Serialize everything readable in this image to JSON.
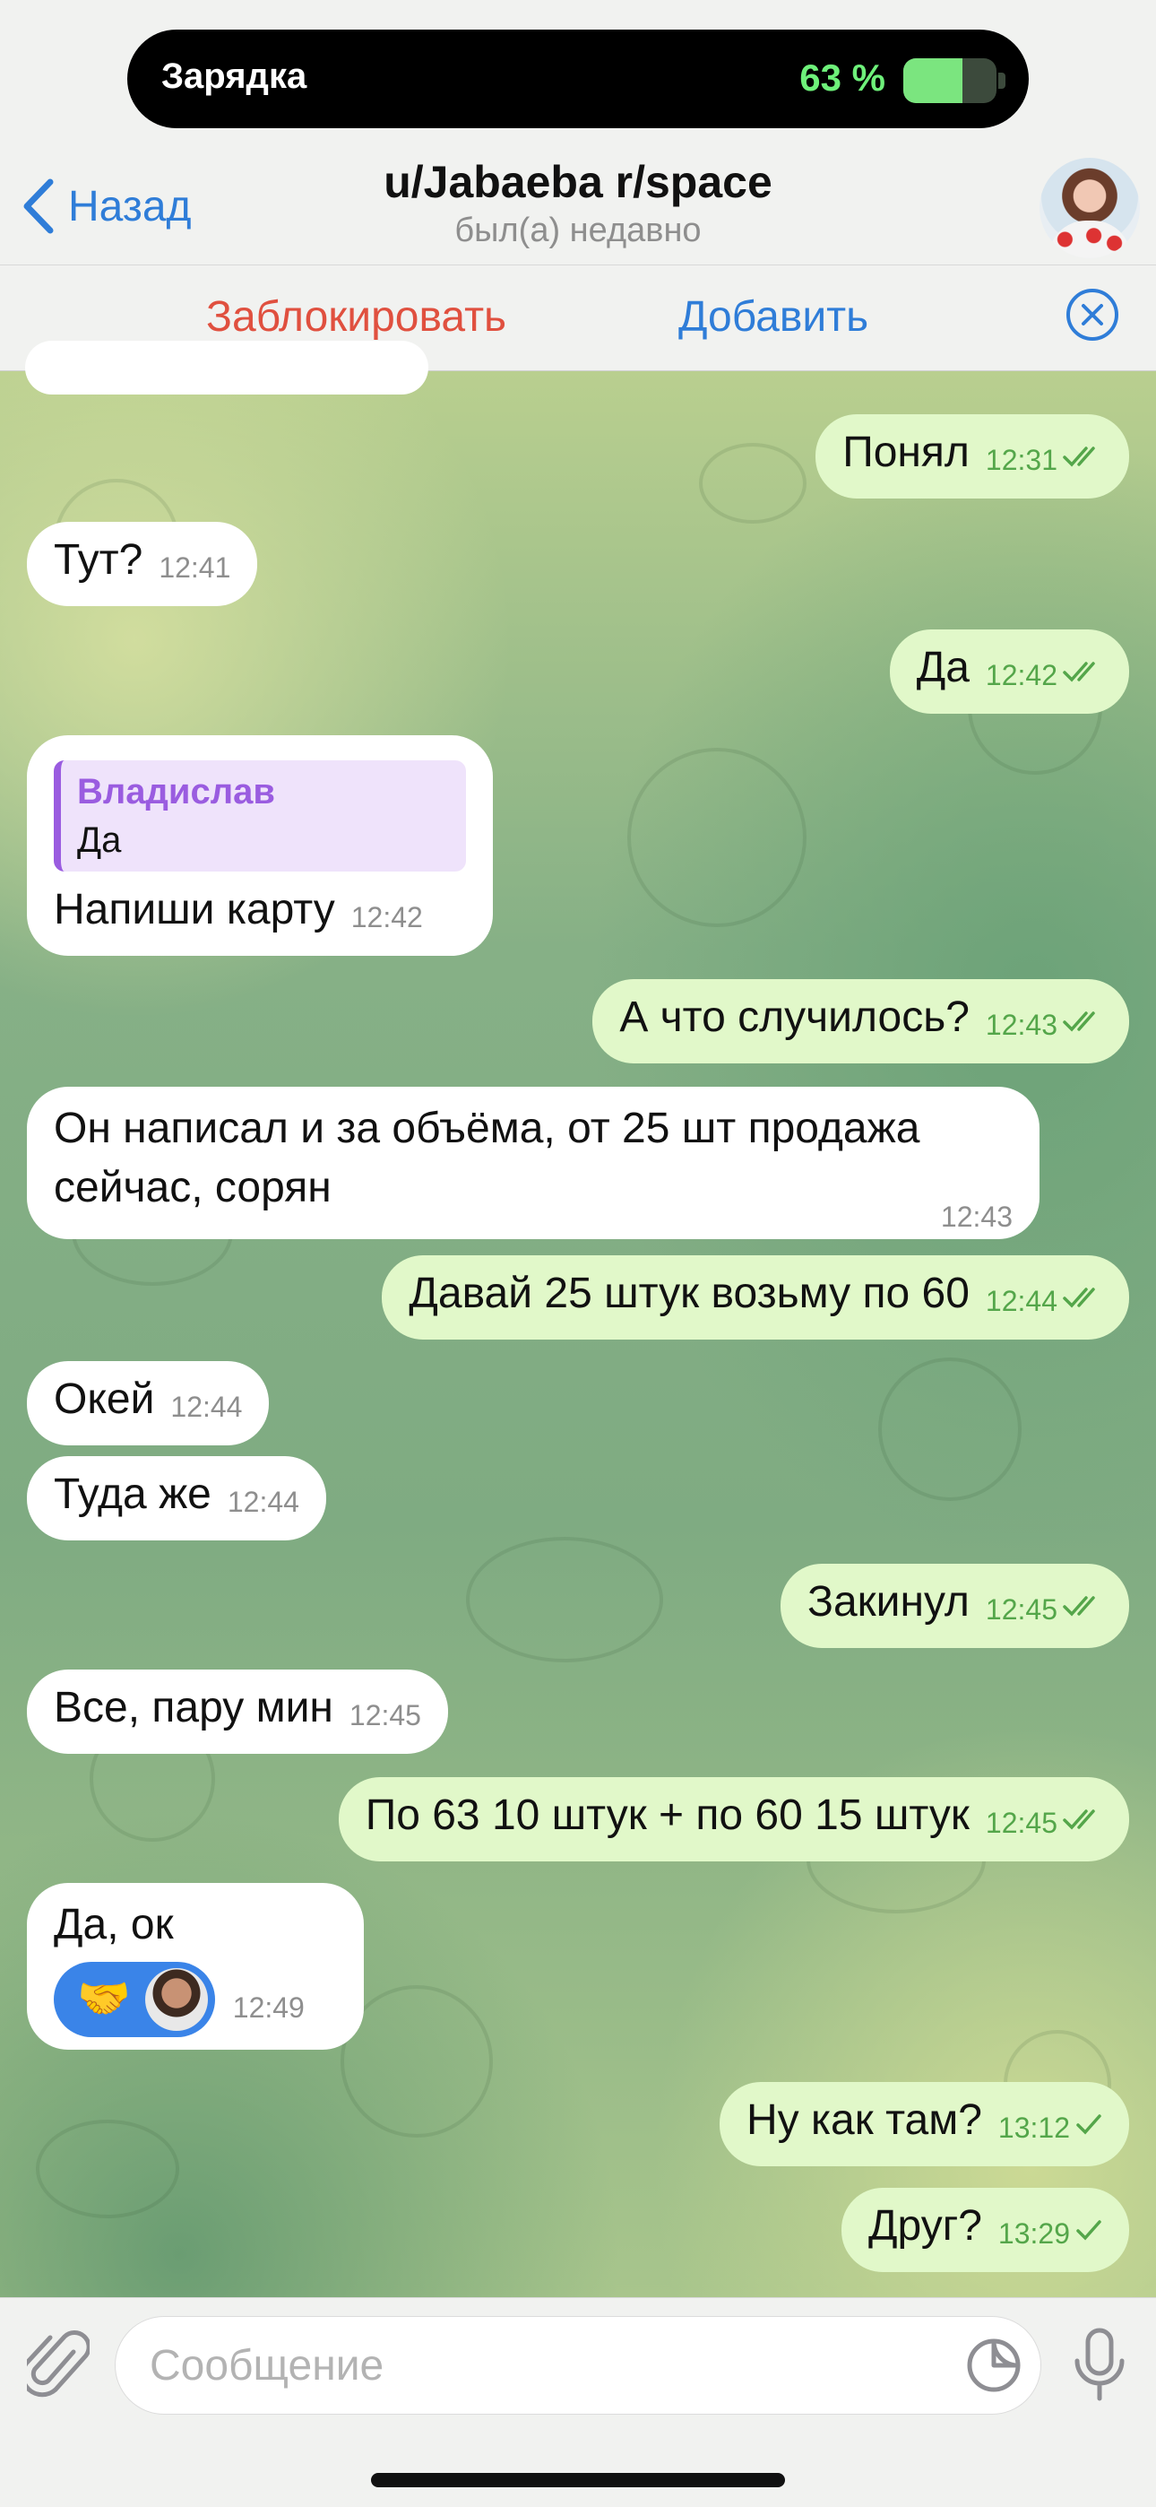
{
  "status_island": {
    "label": "Зарядка",
    "battery_text": "63 %",
    "battery_level": 0.63,
    "battery_color": "#7be57f"
  },
  "header": {
    "back_label": "Назад",
    "title": "u/Jabaeba r/space",
    "status": "был(а) недавно"
  },
  "action_bar": {
    "block_label": "Заблокировать",
    "add_label": "Добавить"
  },
  "colors": {
    "accent": "#2f7dd8",
    "danger": "#e0503f",
    "outgoing_bubble": "#e1f8c9",
    "incoming_bubble": "#ffffff",
    "reply_accent": "#9a5ce0"
  },
  "messages": [
    {
      "dir": "out",
      "text": "Понял",
      "time": "12:31",
      "read": true
    },
    {
      "dir": "in",
      "text": "Тут?",
      "time": "12:41"
    },
    {
      "dir": "out",
      "text": "Да",
      "time": "12:42",
      "read": true
    },
    {
      "dir": "in",
      "reply_to": {
        "author": "Владислав",
        "text": "Да"
      },
      "text": "Напиши карту",
      "time": "12:42"
    },
    {
      "dir": "out",
      "text": "А что случилось?",
      "time": "12:43",
      "read": true
    },
    {
      "dir": "in",
      "text_lines": [
        "Он написал и за объёма, от 25 шт продажа",
        "сейчас, сорян"
      ],
      "time": "12:43"
    },
    {
      "dir": "out",
      "text": "Давай 25 штук возьму по 60",
      "time": "12:44",
      "read": true
    },
    {
      "dir": "in",
      "text": "Окей",
      "time": "12:44"
    },
    {
      "dir": "in",
      "text": "Туда же",
      "time": "12:44"
    },
    {
      "dir": "out",
      "text": "Закинул",
      "time": "12:45",
      "read": true
    },
    {
      "dir": "in",
      "text": "Все, пару мин",
      "time": "12:45"
    },
    {
      "dir": "out",
      "text": "По 63 10 штук + по 60 15 штук",
      "time": "12:45",
      "read": true
    },
    {
      "dir": "in",
      "text": "Да, ок",
      "time": "12:49",
      "reaction": {
        "emoji": "🤝",
        "icon": "handshake-icon"
      }
    },
    {
      "dir": "out",
      "text": "Ну как там?",
      "time": "13:12",
      "read": false
    },
    {
      "dir": "out",
      "text": "Друг?",
      "time": "13:29",
      "read": false
    }
  ],
  "composer": {
    "placeholder": "Сообщение"
  }
}
